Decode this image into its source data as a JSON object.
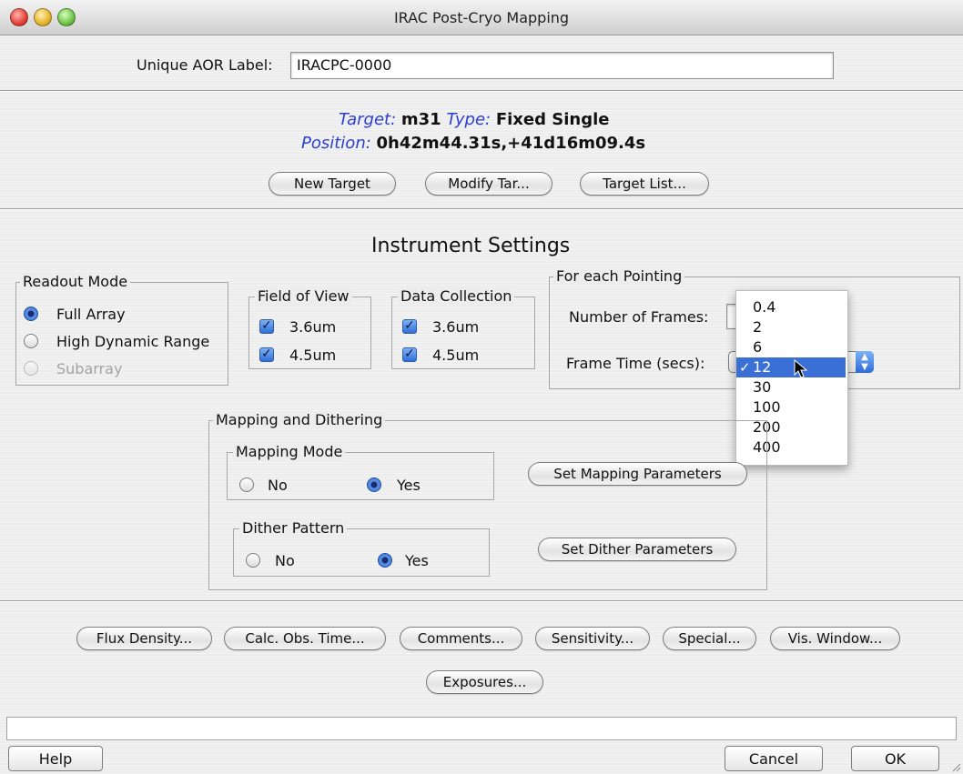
{
  "window": {
    "title": "IRAC Post-Cryo Mapping"
  },
  "aor": {
    "label": "Unique AOR Label:",
    "value": "IRACPC-0000"
  },
  "target": {
    "target_key": "Target:",
    "target_value": "m31",
    "type_key": "Type:",
    "type_value": "Fixed Single",
    "position_key": "Position:",
    "position_value": "0h42m44.31s,+41d16m09.4s",
    "buttons": {
      "new": "New Target",
      "modify": "Modify Tar...",
      "list": "Target List..."
    }
  },
  "instrument": {
    "heading": "Instrument Settings",
    "readout": {
      "title": "Readout Mode",
      "options": [
        {
          "label": "Full Array",
          "selected": true,
          "enabled": true
        },
        {
          "label": "High Dynamic Range",
          "selected": false,
          "enabled": true
        },
        {
          "label": "Subarray",
          "selected": false,
          "enabled": false
        }
      ]
    },
    "fov": {
      "title": "Field of View",
      "items": [
        "3.6um",
        "4.5um"
      ]
    },
    "data_collection": {
      "title": "Data Collection",
      "items": [
        "3.6um",
        "4.5um"
      ]
    },
    "pointing": {
      "title": "For each Pointing",
      "frames_label": "Number of Frames:",
      "frame_time_label": "Frame Time (secs):",
      "frame_time_options": [
        "0.4",
        "2",
        "6",
        "12",
        "30",
        "100",
        "200",
        "400"
      ],
      "frame_time_selected": "12"
    }
  },
  "mapping": {
    "title": "Mapping and Dithering",
    "mapping_mode": {
      "title": "Mapping Mode",
      "no": "No",
      "yes": "Yes",
      "selected": "Yes"
    },
    "dither": {
      "title": "Dither Pattern",
      "no": "No",
      "yes": "Yes",
      "selected": "Yes"
    },
    "set_mapping": "Set Mapping Parameters",
    "set_dither": "Set Dither Parameters"
  },
  "actions": [
    "Flux Density...",
    "Calc. Obs. Time...",
    "Comments...",
    "Sensitivity...",
    "Special...",
    "Vis. Window...",
    "Exposures..."
  ],
  "footer": {
    "help": "Help",
    "cancel": "Cancel",
    "ok": "OK"
  },
  "icons": {
    "check": "checkmark-icon",
    "popup": "popup-arrows-icon",
    "cursor": "arrow-cursor-icon"
  },
  "colors": {
    "accent_blue": "#2a3fd4",
    "selection": "#3a6fd6"
  }
}
